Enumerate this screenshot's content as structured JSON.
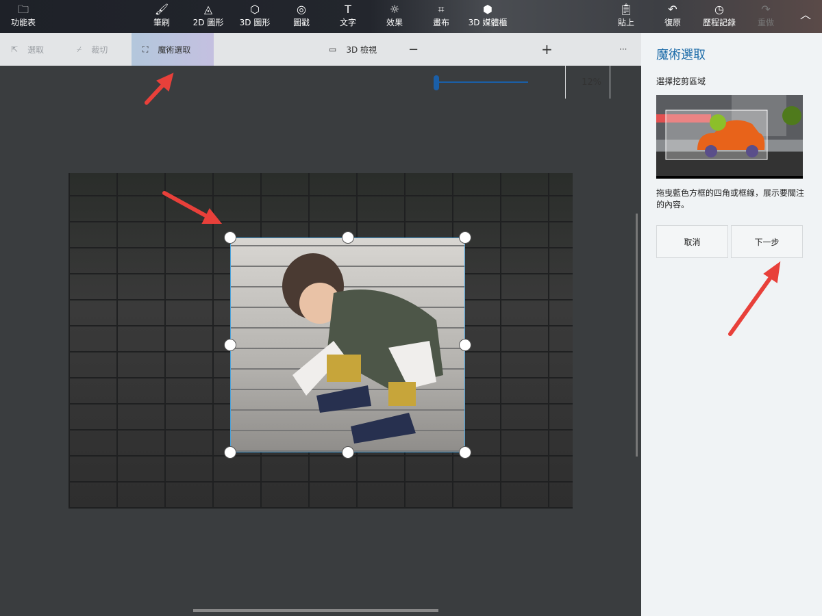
{
  "toolbar": {
    "menu": "功能表",
    "items": [
      {
        "label": "筆刷",
        "icon": "brush-icon"
      },
      {
        "label": "2D 圖形",
        "icon": "shapes-2d-icon"
      },
      {
        "label": "3D 圖形",
        "icon": "shapes-3d-icon"
      },
      {
        "label": "圖戳",
        "icon": "sticker-icon"
      },
      {
        "label": "文字",
        "icon": "text-icon"
      },
      {
        "label": "效果",
        "icon": "effects-icon"
      },
      {
        "label": "畫布",
        "icon": "canvas-icon"
      },
      {
        "label": "3D 媒體櫃",
        "icon": "3d-library-icon"
      }
    ],
    "paste": "貼上",
    "undo": "復原",
    "history": "歷程記錄",
    "redo": "重做"
  },
  "subbar": {
    "select": "選取",
    "crop": "裁切",
    "magic_select": "魔術選取",
    "view3d": "3D 檢視",
    "zoom": "12%",
    "more": "···",
    "zoom_fraction": 0.02
  },
  "panel": {
    "title": "魔術選取",
    "subtitle": "選擇挖剪區域",
    "description": "拖曳藍色方框的四角或框線，展示要關注的內容。",
    "cancel": "取消",
    "next": "下一步"
  },
  "colors": {
    "accent": "#1a5fa8",
    "arrow": "#e8403a"
  }
}
